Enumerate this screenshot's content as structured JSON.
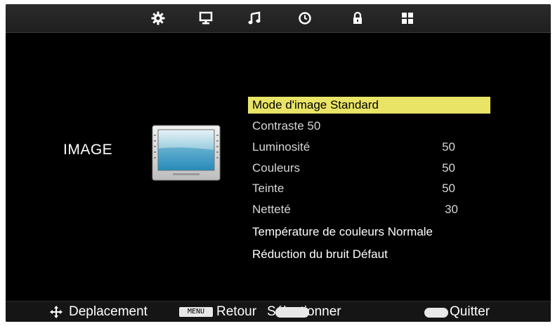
{
  "top_menu": {
    "icons": [
      "gear-icon",
      "monitor-icon",
      "music-note-icon",
      "clock-icon",
      "lock-icon",
      "grid-icon"
    ],
    "active": "monitor-icon"
  },
  "section": {
    "title": "IMAGE",
    "icon": "tv-screen-icon"
  },
  "menu": {
    "items": [
      {
        "label": "Mode d'image Standard",
        "value": "",
        "selected": true
      },
      {
        "label": "Contraste 50",
        "value": "",
        "selected": false
      },
      {
        "label": "Luminosité",
        "value": "50",
        "selected": false
      },
      {
        "label": "Couleurs",
        "value": "50",
        "selected": false
      },
      {
        "label": "Teinte",
        "value": "50",
        "selected": false
      },
      {
        "label": "Netteté",
        "value": "30",
        "selected": false
      },
      {
        "label": "Température de couleurs Normale",
        "value": "",
        "selected": false
      },
      {
        "label": "Réduction du bruit Défaut",
        "value": "",
        "selected": false
      }
    ]
  },
  "footer": {
    "move_label": "Deplacement",
    "menu_key": "MENU",
    "back_label": "Retour",
    "select_label": "Sélectionner",
    "exit_label": "Quitter"
  },
  "colors": {
    "highlight": "#e9e466",
    "background": "#000000",
    "text": "#ffffff"
  }
}
